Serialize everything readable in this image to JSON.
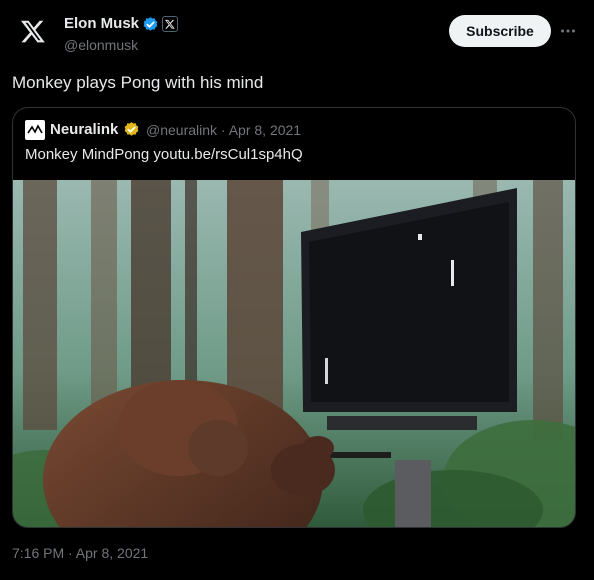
{
  "author": {
    "name": "Elon Musk",
    "handle": "@elonmusk",
    "verified_badge_color": "#1d9bf0",
    "affiliate_badge": "x-logo-icon"
  },
  "subscribe_label": "Subscribe",
  "more_icon": "more-horizontal-icon",
  "post_text": "Monkey plays Pong with his mind",
  "quote": {
    "name": "Neuralink",
    "handle": "@neuralink",
    "separator": " · ",
    "date": "Apr 8, 2021",
    "text": "Monkey MindPong",
    "link": "youtu.be/rsCul1sp4hQ",
    "verified_badge_color": "#e2b719"
  },
  "media": {
    "description_icon": "video-thumbnail",
    "scene": "monkey-using-joystick-in-front-of-pong-monitor-forest-background"
  },
  "timestamp": "7:16 PM · Apr 8, 2021",
  "colors": {
    "background": "#000000",
    "text_primary": "#e7e9ea",
    "text_secondary": "#71767b",
    "border": "#2f3336",
    "button_bg": "#eff3f4"
  }
}
